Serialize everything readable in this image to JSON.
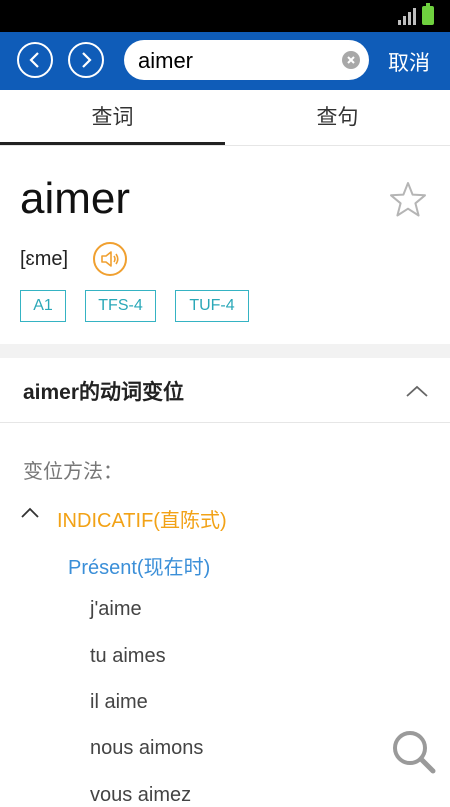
{
  "toolbar": {
    "search_value": "aimer",
    "cancel_label": "取消",
    "accent_color": "#0f5cb8"
  },
  "tabs": [
    {
      "label": "查词",
      "active": true
    },
    {
      "label": "查句",
      "active": false
    }
  ],
  "entry": {
    "word": "aimer",
    "phonetic": "[ɛme]",
    "levels": [
      "A1",
      "TFS-4",
      "TUF-4"
    ]
  },
  "conjugation": {
    "section_title": "aimer的动词变位",
    "method_label": "变位方法：",
    "mood": "INDICATIF(直陈式)",
    "tense": "Présent(现在时)",
    "forms": [
      "j'aime",
      "tu aimes",
      "il aime",
      "nous aimons",
      "vous aimez"
    ]
  },
  "icons": {
    "back": "chevron-left-icon",
    "forward": "chevron-right-icon",
    "clear": "clear-icon",
    "favorite": "star-icon",
    "audio": "speaker-icon",
    "collapse": "chevron-up-icon",
    "float_search": "search-icon"
  }
}
